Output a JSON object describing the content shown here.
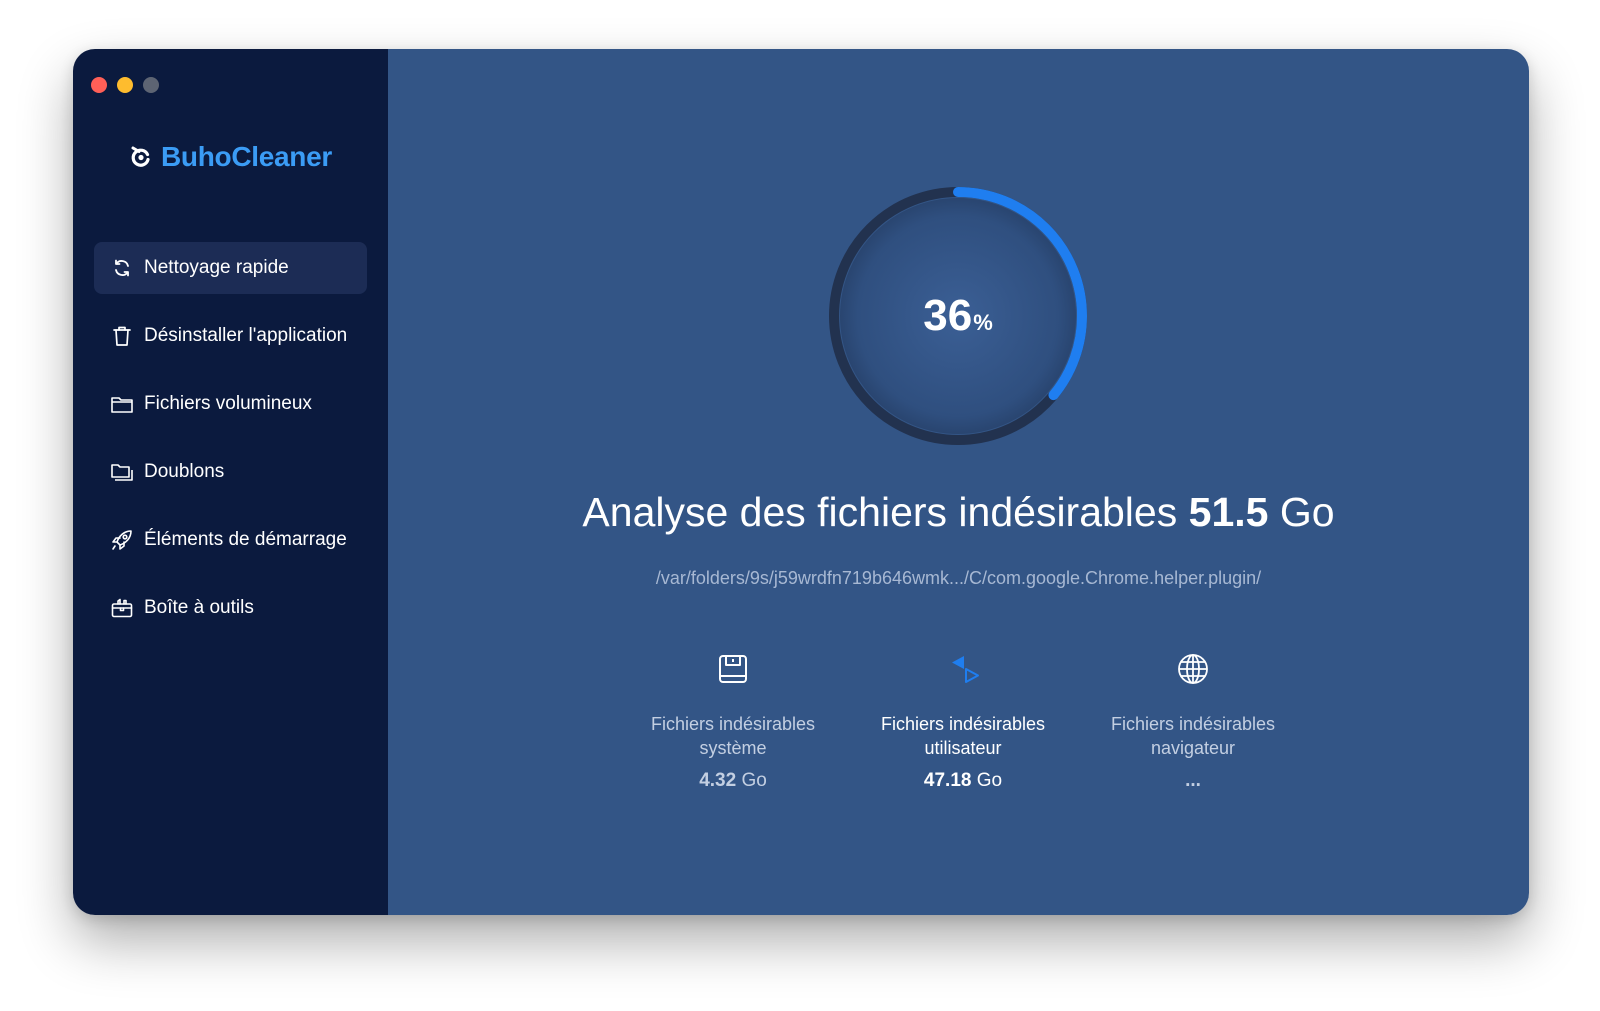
{
  "app": {
    "name": "BuhoCleaner",
    "brand_color": "#3b9cf5"
  },
  "sidebar": {
    "items": [
      {
        "label": "Nettoyage rapide",
        "icon": "refresh-icon",
        "active": true
      },
      {
        "label": "Désinstaller l'application",
        "icon": "trash-icon",
        "active": false
      },
      {
        "label": "Fichiers volumineux",
        "icon": "folder-icon",
        "active": false
      },
      {
        "label": "Doublons",
        "icon": "duplicate-folder-icon",
        "active": false
      },
      {
        "label": "Éléments de démarrage",
        "icon": "rocket-icon",
        "active": false
      },
      {
        "label": "Boîte à outils",
        "icon": "toolbox-icon",
        "active": false
      }
    ]
  },
  "scan": {
    "progress_percent": 36,
    "percent_number": "36",
    "percent_symbol": "%",
    "title_prefix": "Analyse des fichiers indésirables",
    "size_number": "51.5",
    "size_unit": "Go",
    "current_path": "/var/folders/9s/j59wrdfn719b646wmk.../C/com.google.Chrome.helper.plugin/",
    "accent_color": "#1f7ef0",
    "track_color": "#22324f"
  },
  "categories": [
    {
      "label_line1": "Fichiers indésirables",
      "label_line2": "système",
      "value_number": "4.32",
      "value_unit": "Go",
      "icon": "disk-icon"
    },
    {
      "label_line1": "Fichiers indésirables",
      "label_line2": "utilisateur",
      "value_number": "47.18",
      "value_unit": "Go",
      "icon": "user-files-icon"
    },
    {
      "label_line1": "Fichiers indésirables",
      "label_line2": "navigateur",
      "value_number": "...",
      "value_unit": "",
      "icon": "globe-icon"
    }
  ]
}
